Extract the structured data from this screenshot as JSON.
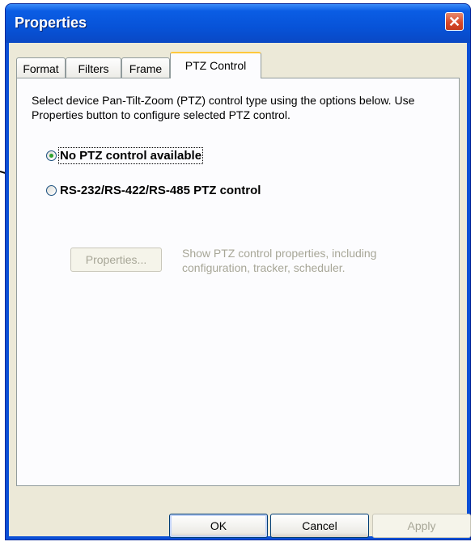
{
  "window": {
    "title": "Properties"
  },
  "tabs": [
    {
      "label": "Format",
      "active": false
    },
    {
      "label": "Filters",
      "active": false
    },
    {
      "label": "Frame",
      "active": false
    },
    {
      "label": "PTZ Control",
      "active": true
    }
  ],
  "panel": {
    "description": "Select device Pan-Tilt-Zoom (PTZ) control type using the options below. Use Properties button to configure selected PTZ control.",
    "options": [
      {
        "label": "No PTZ control available",
        "selected": true
      },
      {
        "label": "RS-232/RS-422/RS-485 PTZ control",
        "selected": false
      }
    ],
    "properties_button": "Properties...",
    "properties_description": "Show PTZ control properties, including configuration, tracker, scheduler."
  },
  "footer": {
    "ok": "OK",
    "cancel": "Cancel",
    "apply": "Apply"
  },
  "colors": {
    "titlebar": "#0753d8",
    "face": "#ece9d8",
    "selected_radio": "#2fa12f"
  }
}
